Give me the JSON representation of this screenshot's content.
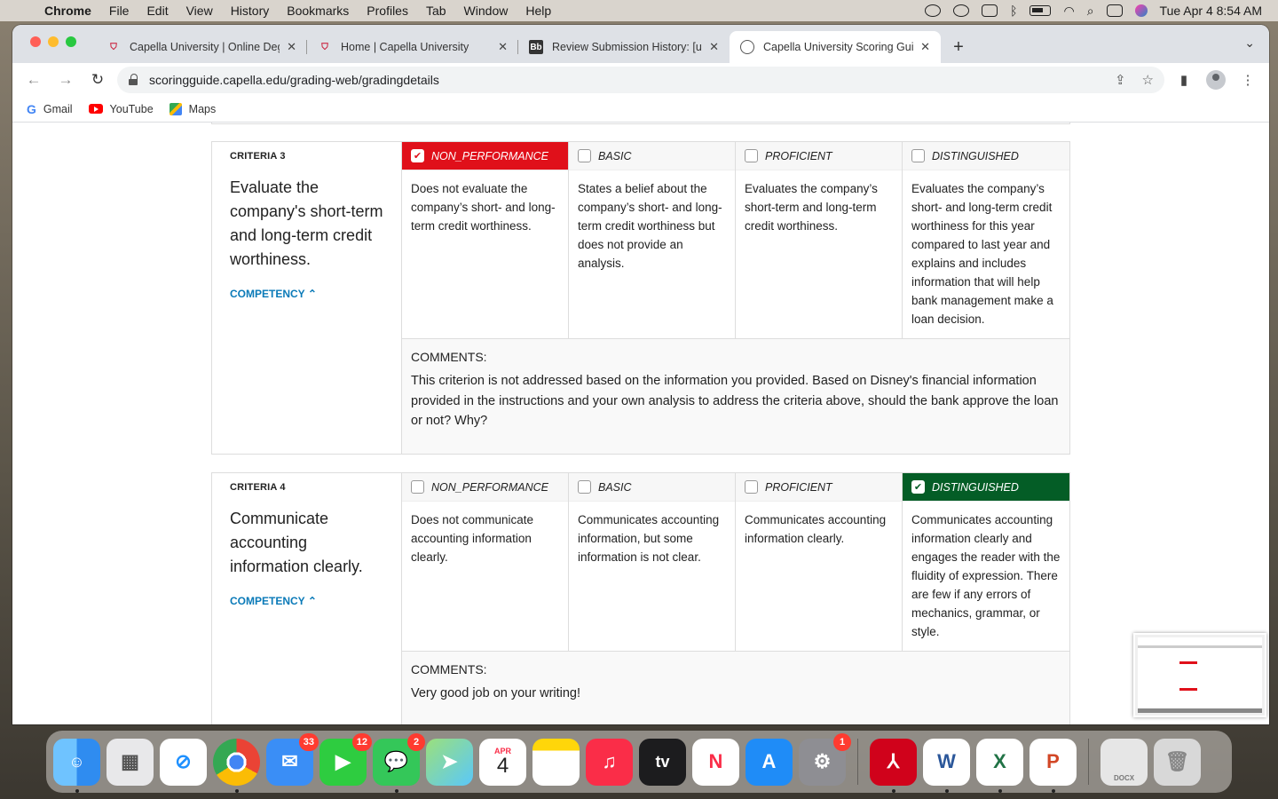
{
  "menubar": {
    "app_name": "Chrome",
    "items": [
      "File",
      "Edit",
      "View",
      "History",
      "Bookmarks",
      "Profiles",
      "Tab",
      "Window",
      "Help"
    ],
    "clock": "Tue Apr 4  8:54 AM"
  },
  "tabs": [
    {
      "label": "Capella University | Online Deg",
      "icon": "capella-shield-icon"
    },
    {
      "label": "Home | Capella University",
      "icon": "capella-shield-icon"
    },
    {
      "label": "Review Submission History: [u",
      "icon": "blackboard-icon"
    },
    {
      "label": "Capella University Scoring Gui",
      "icon": "globe-icon"
    }
  ],
  "address_bar": {
    "url": "scoringguide.capella.edu/grading-web/gradingdetails"
  },
  "bookmarks": [
    "Gmail",
    "YouTube",
    "Maps"
  ],
  "criteria": [
    {
      "label": "CRITERIA 3",
      "title": "Evaluate the company's short-term and long-term credit worthiness.",
      "competency": "COMPETENCY",
      "levels": [
        {
          "name": "NON_PERFORMANCE",
          "selected": true,
          "desc": "Does not evaluate the company’s short- and long-term credit worthiness."
        },
        {
          "name": "BASIC",
          "selected": false,
          "desc": "States a belief about the company’s short- and long-term credit worthiness but does not provide an analysis."
        },
        {
          "name": "PROFICIENT",
          "selected": false,
          "desc": "Evaluates the company’s short-term and long-term credit worthiness."
        },
        {
          "name": "DISTINGUISHED",
          "selected": false,
          "desc": "Evaluates the company’s short- and long-term credit worthiness for this year compared to last year and explains and includes information that will help bank management make a loan decision."
        }
      ],
      "comments_label": "COMMENTS:",
      "comment": "This criterion is not addressed based on the information you provided. Based on Disney's financial information provided in the instructions and your own analysis to address the criteria above, should the bank approve the loan or not? Why?"
    },
    {
      "label": "CRITERIA 4",
      "title": "Communicate accounting information clearly.",
      "competency": "COMPETENCY",
      "levels": [
        {
          "name": "NON_PERFORMANCE",
          "selected": false,
          "desc": "Does not communicate accounting information clearly."
        },
        {
          "name": "BASIC",
          "selected": false,
          "desc": "Communicates accounting information, but some information is not clear."
        },
        {
          "name": "PROFICIENT",
          "selected": false,
          "desc": "Communicates accounting information clearly."
        },
        {
          "name": "DISTINGUISHED",
          "selected": true,
          "desc": "Communicates accounting information clearly and engages the reader with the fluidity of expression. There are few if any errors of mechanics, grammar, or style."
        }
      ],
      "comments_label": "COMMENTS:",
      "comment": "Very good job on your writing!"
    }
  ],
  "dock": {
    "apps": [
      {
        "name": "Finder",
        "color": "#2f8cf0",
        "badge": ""
      },
      {
        "name": "Launchpad",
        "color": "#e8e8ea",
        "badge": ""
      },
      {
        "name": "Safari",
        "color": "#1e90ff",
        "badge": ""
      },
      {
        "name": "Chrome",
        "color": "#ffffff",
        "badge": ""
      },
      {
        "name": "Mail",
        "color": "#3a8ef6",
        "badge": "33"
      },
      {
        "name": "FaceTime",
        "color": "#2ecc40",
        "badge": "12"
      },
      {
        "name": "Messages",
        "color": "#34c759",
        "badge": "2"
      },
      {
        "name": "Maps",
        "color": "#5ac8fa",
        "badge": ""
      },
      {
        "name": "Calendar",
        "color": "#ffffff",
        "badge": ""
      },
      {
        "name": "Notes",
        "color": "#ffd60a",
        "badge": ""
      },
      {
        "name": "Music",
        "color": "#fa2d48",
        "badge": ""
      },
      {
        "name": "TV",
        "color": "#1c1c1e",
        "badge": ""
      },
      {
        "name": "News",
        "color": "#ffffff",
        "badge": ""
      },
      {
        "name": "App Store",
        "color": "#1f8cf7",
        "badge": ""
      },
      {
        "name": "System Preferences",
        "color": "#8e8e93",
        "badge": "1"
      },
      {
        "name": "Acrobat",
        "color": "#d0021b",
        "badge": ""
      },
      {
        "name": "Word",
        "color": "#ffffff",
        "badge": ""
      },
      {
        "name": "Excel",
        "color": "#ffffff",
        "badge": ""
      },
      {
        "name": "PowerPoint",
        "color": "#ffffff",
        "badge": ""
      },
      {
        "name": "Document",
        "color": "#e6e6e6",
        "badge": ""
      },
      {
        "name": "Trash",
        "color": "#d8d8d8",
        "badge": ""
      }
    ],
    "calendar_month": "APR",
    "calendar_day": "4",
    "tv_label": "tv",
    "doc_label": "DOCX"
  },
  "colors": {
    "non_performance": "#e0101a",
    "distinguished": "#045d26",
    "competency_link": "#0a7ab8"
  }
}
